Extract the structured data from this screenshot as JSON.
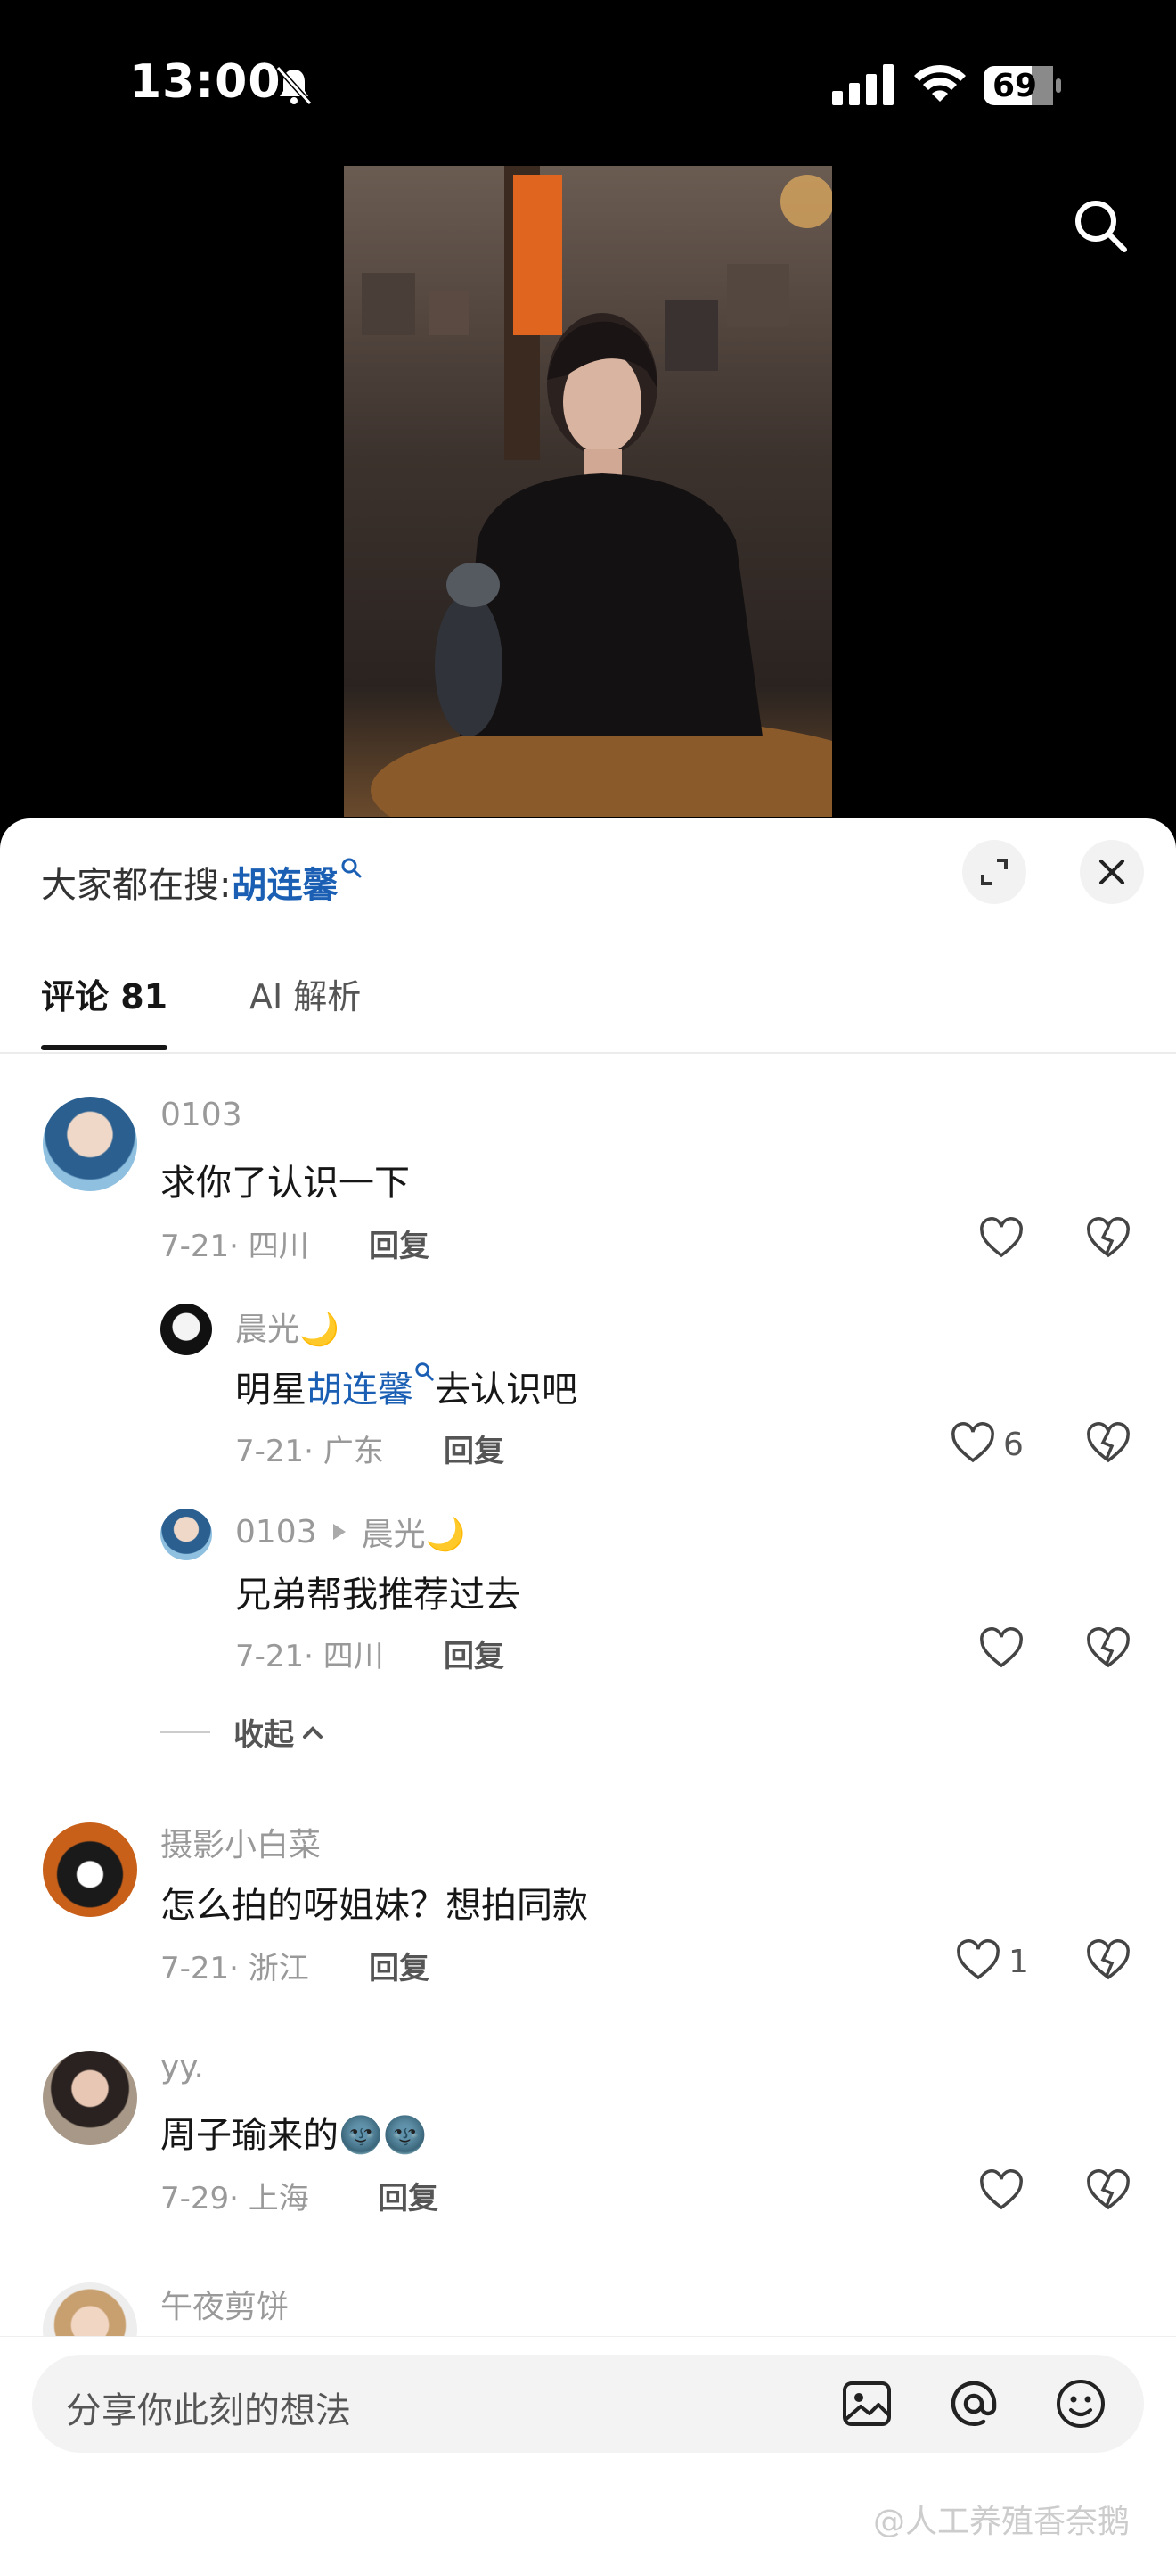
{
  "status_bar": {
    "time": "13:00",
    "battery": "69"
  },
  "sheet": {
    "hot_search_prefix": "大家都在搜:",
    "hot_search_term": "胡连馨",
    "tabs": [
      {
        "label": "评论 81"
      },
      {
        "label": "AI 解析"
      }
    ]
  },
  "comments": [
    {
      "username": "0103",
      "text": "求你了认识一下",
      "meta": "7-21· 四川",
      "reply_label": "回复",
      "likes": ""
    },
    {
      "username": "晨光🌙",
      "text_before": "明星",
      "text_link": "胡连馨",
      "text_after": "去认识吧",
      "meta": "7-21· 广东",
      "reply_label": "回复",
      "likes": "6"
    },
    {
      "username": "0103",
      "reply_to": "晨光🌙",
      "text": "兄弟帮我推荐过去",
      "meta": "7-21· 四川",
      "reply_label": "回复",
      "likes": ""
    },
    {
      "collapse_label": "收起"
    },
    {
      "username": "摄影小白菜",
      "text": "怎么拍的呀姐妹？想拍同款",
      "meta": "7-21· 浙江",
      "reply_label": "回复",
      "likes": "1"
    },
    {
      "username": "yy.",
      "text": "周子瑜来的🌚🌚",
      "meta": "7-29· 上海",
      "reply_label": "回复",
      "likes": ""
    },
    {
      "username": "午夜剪饼"
    }
  ],
  "input": {
    "placeholder": "分享你此刻的想法"
  },
  "watermark": "@人工养殖香奈鹅",
  "colors": {
    "link": "#1a5fb4",
    "muted": "#999999"
  }
}
